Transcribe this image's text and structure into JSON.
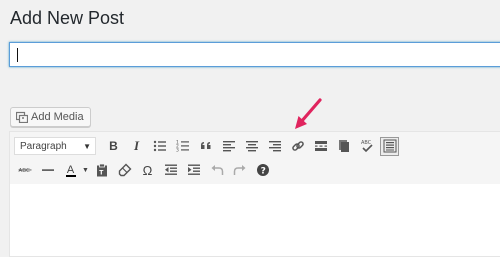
{
  "page": {
    "title": "Add New Post"
  },
  "title_field": {
    "value": ""
  },
  "media": {
    "add_media_label": "Add Media"
  },
  "toolbar": {
    "format_select": {
      "selected": "Paragraph"
    },
    "row1_icons": [
      "bold-icon",
      "italic-icon",
      "bullet-list-icon",
      "numbered-list-icon",
      "blockquote-icon",
      "align-left-icon",
      "align-center-icon",
      "align-right-icon",
      "link-icon",
      "read-more-icon",
      "kitchen-sink-icon",
      "spellcheck-icon",
      "distraction-free-icon"
    ],
    "row2_icons": [
      "strikethrough-icon",
      "horizontal-line-icon",
      "text-color-icon",
      "paste-text-icon",
      "clear-formatting-icon",
      "special-character-icon",
      "outdent-icon",
      "indent-icon",
      "undo-icon",
      "redo-icon",
      "help-icon"
    ],
    "bold_label": "B",
    "italic_label": "I",
    "text_color_label": "A",
    "omega_label": "Ω",
    "help_label": "?"
  },
  "annotation": {
    "arrow_color": "#e0245e"
  }
}
